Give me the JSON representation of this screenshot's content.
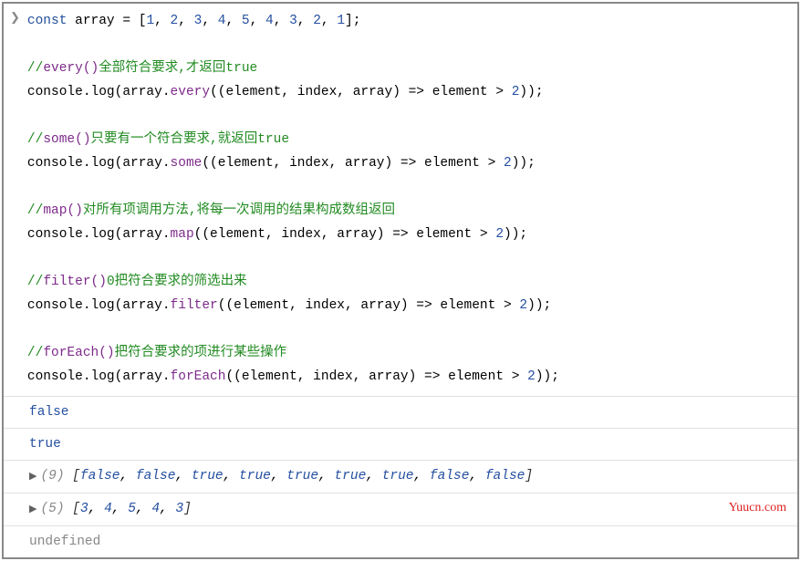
{
  "code": {
    "l1_kw": "const",
    "l1_rest": " array = [",
    "l1_nums": [
      "1",
      "2",
      "3",
      "4",
      "5",
      "4",
      "3",
      "2",
      "1"
    ],
    "l1_end": "];",
    "c1_pre": "//",
    "c1_m": "every()",
    "c1_txt": "全部符合要求,才返回true",
    "l2_a": "console.log(array.",
    "l2_m": "every",
    "l2_b": "((element, index, array) => element > ",
    "l2_n": "2",
    "l2_c": "));",
    "c2_pre": "//",
    "c2_m": "some()",
    "c2_txt": "只要有一个符合要求,就返回true",
    "l3_a": "console.log(array.",
    "l3_m": "some",
    "l3_b": "((element, index, array) => element > ",
    "l3_n": "2",
    "l3_c": "));",
    "c3_pre": "//",
    "c3_m": "map()",
    "c3_txt": "对所有项调用方法,将每一次调用的结果构成数组返回",
    "l4_a": "console.log(array.",
    "l4_m": "map",
    "l4_b": "((element, index, array) => element > ",
    "l4_n": "2",
    "l4_c": "));",
    "c4_pre": "//",
    "c4_m": "filter()",
    "c4_txt": "0把符合要求的筛选出来",
    "l5_a": "console.log(array.",
    "l5_m": "filter",
    "l5_b": "((element, index, array) => element > ",
    "l5_n": "2",
    "l5_c": "));",
    "c5_pre": "//",
    "c5_m": "forEach()",
    "c5_txt": "把符合要求的项进行某些操作",
    "l6_a": "console.log(array.",
    "l6_m": "forEach",
    "l6_b": "((element, index, array) => element > ",
    "l6_n": "2",
    "l6_c": "));"
  },
  "outputs": {
    "o1": "false",
    "o2": "true",
    "o3_len": "(9) ",
    "o3_vals": [
      "false",
      "false",
      "true",
      "true",
      "true",
      "true",
      "true",
      "false",
      "false"
    ],
    "o4_len": "(5) ",
    "o4_vals": [
      "3",
      "4",
      "5",
      "4",
      "3"
    ],
    "o5": "undefined"
  },
  "watermark": "Yuucn.com"
}
